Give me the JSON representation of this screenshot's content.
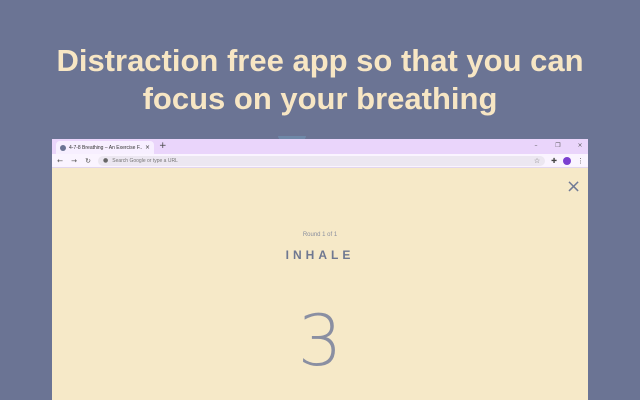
{
  "headline": {
    "line1": "Distraction free app so that you can",
    "line2": "focus on your breathing"
  },
  "browser": {
    "tab_title": "4-7-8 Breathing – An Exercise F...",
    "tab_close": "×",
    "new_tab": "+",
    "window_controls": {
      "minimize": "–",
      "maximize": "❐",
      "close": "×"
    },
    "nav": {
      "back": "←",
      "forward": "→",
      "reload": "↻"
    },
    "omnibox_placeholder": "Search Google or type a URL"
  },
  "app": {
    "close": "×",
    "round": "Round 1 of 1",
    "phase": "INHALE",
    "count": "3"
  },
  "colors": {
    "background": "#6b7494",
    "headline": "#f7e6c4",
    "app_background": "#f6e9c8",
    "tab_bar": "#ead5fb"
  }
}
